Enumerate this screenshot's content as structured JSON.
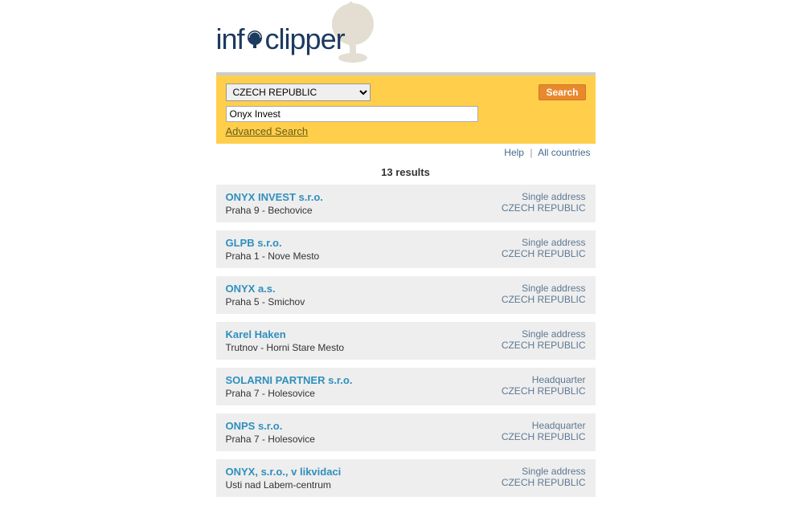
{
  "logo": {
    "text_info": "inf",
    "text_clipper": "clipper"
  },
  "search": {
    "country_options": [
      "CZECH REPUBLIC"
    ],
    "country_selected": "CZECH REPUBLIC",
    "query": "Onyx Invest",
    "button_label": "Search",
    "advanced_label": "Advanced Search"
  },
  "helpbar": {
    "help": "Help",
    "all_countries": "All countries"
  },
  "results_count": "13 results",
  "results": [
    {
      "name": "ONYX INVEST s.r.o.",
      "location": "Praha 9 - Bechovice",
      "addr_type": "Single address",
      "country": "CZECH REPUBLIC"
    },
    {
      "name": "GLPB s.r.o.",
      "location": "Praha 1 - Nove Mesto",
      "addr_type": "Single address",
      "country": "CZECH REPUBLIC"
    },
    {
      "name": "ONYX a.s.",
      "location": "Praha 5 - Smichov",
      "addr_type": "Single address",
      "country": "CZECH REPUBLIC"
    },
    {
      "name": "Karel Haken",
      "location": "Trutnov - Horni Stare Mesto",
      "addr_type": "Single address",
      "country": "CZECH REPUBLIC"
    },
    {
      "name": "SOLARNI PARTNER s.r.o.",
      "location": "Praha 7 - Holesovice",
      "addr_type": "Headquarter",
      "country": "CZECH REPUBLIC"
    },
    {
      "name": "ONPS s.r.o.",
      "location": "Praha 7 - Holesovice",
      "addr_type": "Headquarter",
      "country": "CZECH REPUBLIC"
    },
    {
      "name": "ONYX, s.r.o., v likvidaci",
      "location": "Usti nad Labem-centrum",
      "addr_type": "Single address",
      "country": "CZECH REPUBLIC"
    }
  ]
}
